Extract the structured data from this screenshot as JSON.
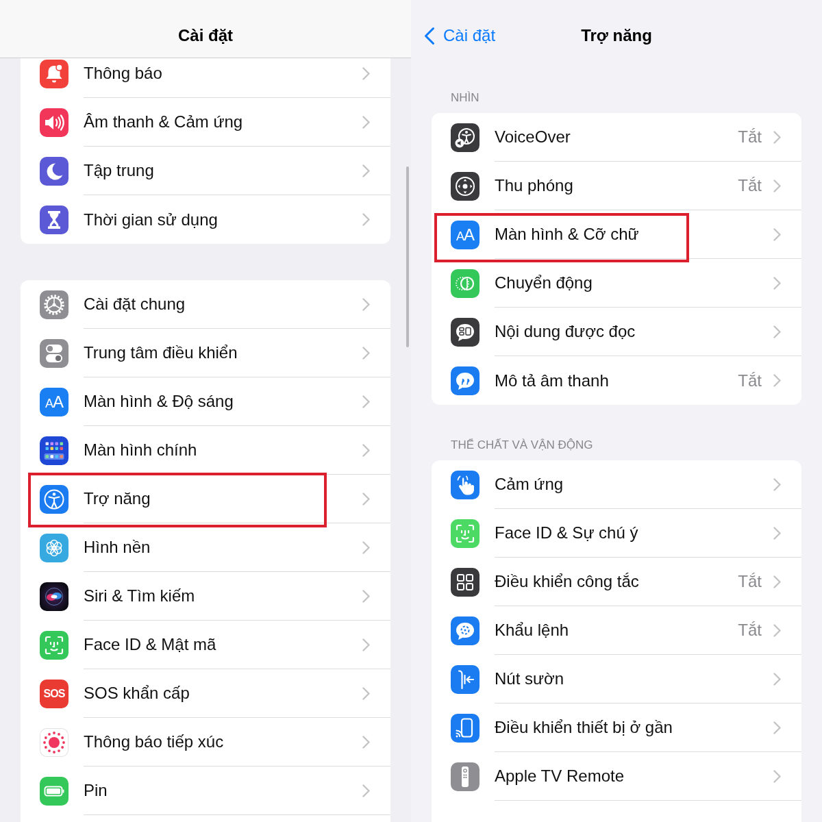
{
  "left_screen": {
    "nav_bar": {
      "title": "Cài đặt"
    },
    "groups": [
      {
        "items": [
          {
            "label": "Thông báo",
            "highlighted": false
          },
          {
            "label": "Âm thanh & Cảm ứng",
            "highlighted": false
          },
          {
            "label": "Tập trung",
            "highlighted": false
          },
          {
            "label": "Thời gian sử dụng",
            "highlighted": false
          }
        ]
      },
      {
        "items": [
          {
            "label": "Cài đặt chung",
            "highlighted": false
          },
          {
            "label": "Trung tâm điều khiển",
            "highlighted": false
          },
          {
            "label": "Màn hình & Độ sáng",
            "icon_glyph": "AA",
            "highlighted": false
          },
          {
            "label": "Màn hình chính",
            "highlighted": false
          },
          {
            "label": "Trợ năng",
            "highlighted": true
          },
          {
            "label": "Hình nền",
            "highlighted": false
          },
          {
            "label": "Siri & Tìm kiếm",
            "highlighted": false
          },
          {
            "label": "Face ID & Mật mã",
            "highlighted": false
          },
          {
            "label": "SOS khẩn cấp",
            "icon_glyph": "SOS",
            "highlighted": false
          },
          {
            "label": "Thông báo tiếp xúc",
            "highlighted": false
          },
          {
            "label": "Pin",
            "highlighted": false
          }
        ]
      }
    ]
  },
  "right_screen": {
    "nav_bar": {
      "back_label": "Cài đặt",
      "title": "Trợ năng"
    },
    "sections": [
      {
        "header": "NHÌN",
        "items": [
          {
            "label": "VoiceOver",
            "value": "Tắt",
            "highlighted": false
          },
          {
            "label": "Thu phóng",
            "value": "Tắt",
            "highlighted": false
          },
          {
            "label": "Màn hình & Cỡ chữ",
            "icon_glyph": "AA",
            "highlighted": true
          },
          {
            "label": "Chuyển động",
            "highlighted": false
          },
          {
            "label": "Nội dung được đọc",
            "highlighted": false
          },
          {
            "label": "Mô tả âm thanh",
            "value": "Tắt",
            "highlighted": false
          }
        ]
      },
      {
        "header": "THỂ CHẤT VÀ VẬN ĐỘNG",
        "items": [
          {
            "label": "Cảm ứng",
            "highlighted": false
          },
          {
            "label": "Face ID & Sự chú ý",
            "highlighted": false
          },
          {
            "label": "Điều khiển công tắc",
            "value": "Tắt",
            "highlighted": false
          },
          {
            "label": "Khẩu lệnh",
            "value": "Tắt",
            "highlighted": false
          },
          {
            "label": "Nút sườn",
            "highlighted": false
          },
          {
            "label": "Điều khiển thiết bị ở gần",
            "highlighted": false
          },
          {
            "label": "Apple TV Remote",
            "highlighted": false
          }
        ]
      }
    ]
  }
}
